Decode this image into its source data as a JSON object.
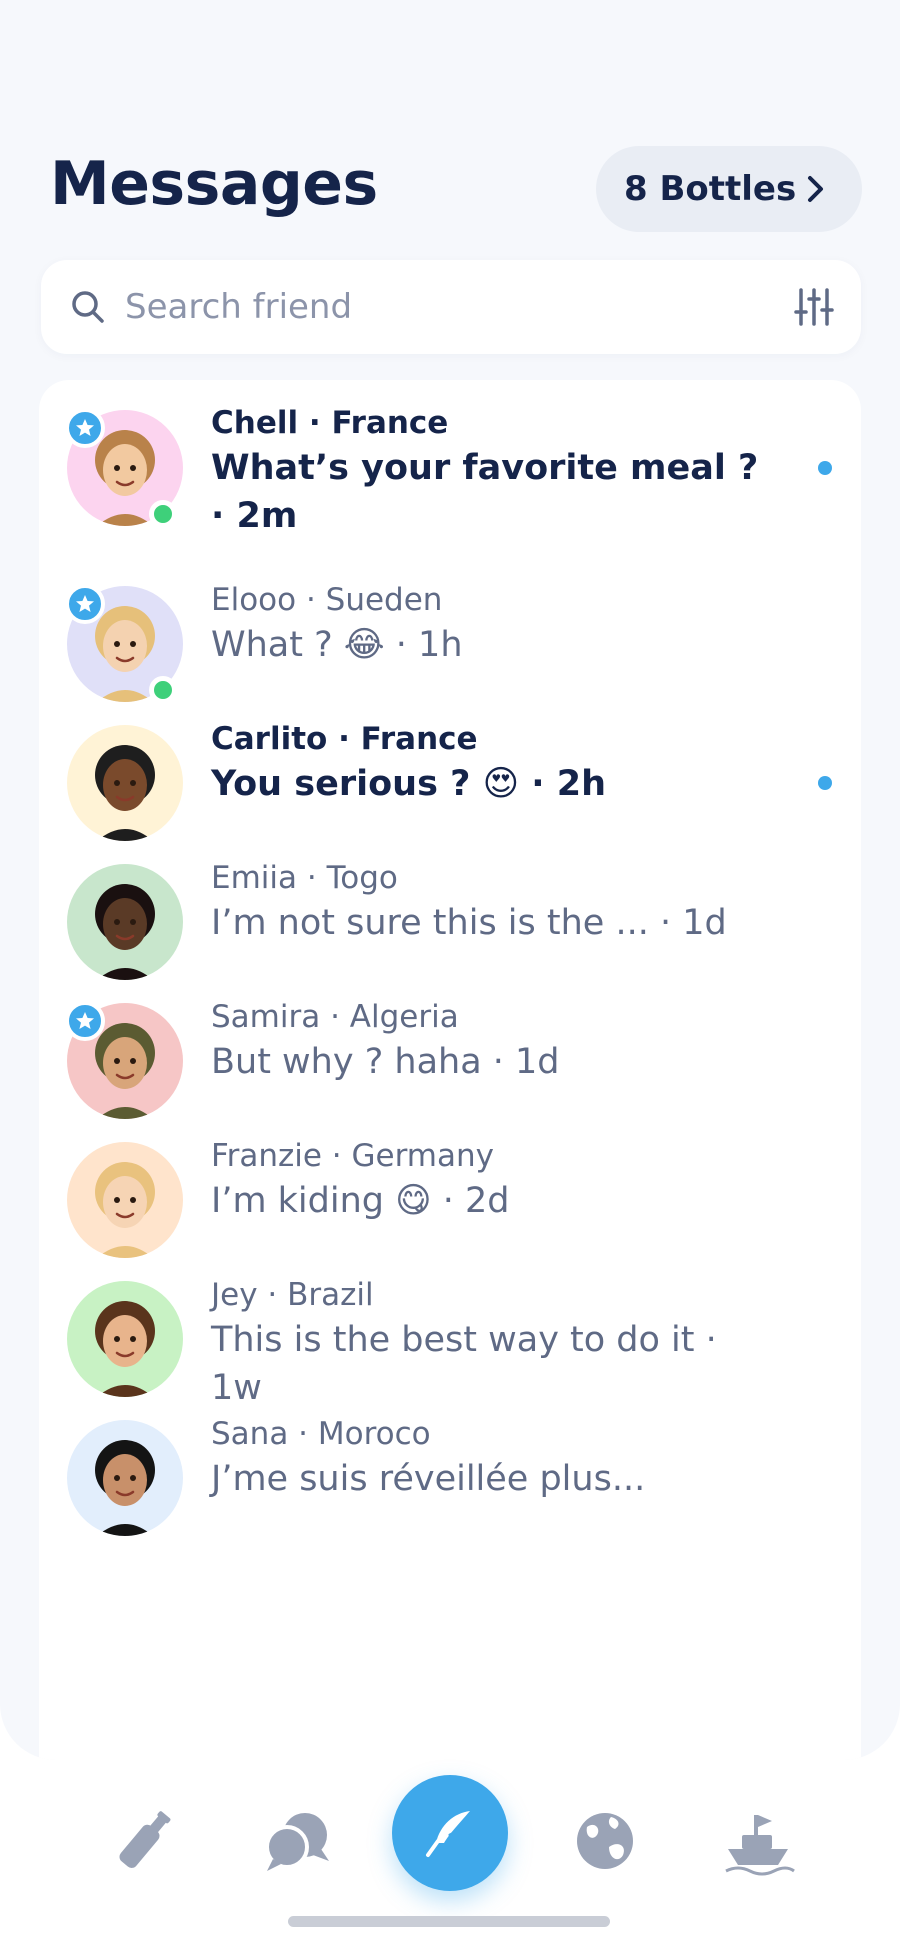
{
  "header": {
    "title": "Messages",
    "bottles_label": "8 Bottles"
  },
  "search": {
    "placeholder": "Search friend",
    "value": ""
  },
  "conversations": [
    {
      "name": "Chell · France",
      "message": "What’s your favorite meal ? · 2m",
      "unread": true,
      "premium": true,
      "online": true,
      "avatar_bg": "#fcd4ef"
    },
    {
      "name": "Elooo · Sueden",
      "message": "What ? 😂 · 1h",
      "unread": false,
      "premium": true,
      "online": true,
      "avatar_bg": "#e0e0f8"
    },
    {
      "name": "Carlito · France",
      "message": "You serious ? 😍 · 2h",
      "unread": true,
      "premium": false,
      "online": false,
      "avatar_bg": "#fff3d6"
    },
    {
      "name": "Emiia · Togo",
      "message": "I’m not sure this is the ... · 1d",
      "unread": false,
      "premium": false,
      "online": false,
      "avatar_bg": "#c8e6cc"
    },
    {
      "name": "Samira · Algeria",
      "message": "But why ? haha · 1d",
      "unread": false,
      "premium": true,
      "online": false,
      "avatar_bg": "#f6c6c6"
    },
    {
      "name": "Franzie · Germany",
      "message": "I’m kiding 😋 · 2d",
      "unread": false,
      "premium": false,
      "online": false,
      "avatar_bg": "#ffe4cc"
    },
    {
      "name": "Jey · Brazil",
      "message": "This is the best way to do it · 1w",
      "unread": false,
      "premium": false,
      "online": false,
      "avatar_bg": "#c8f2c4"
    },
    {
      "name": "Sana · Moroco",
      "message": "J’me suis réveillée plus...",
      "unread": false,
      "premium": false,
      "online": false,
      "avatar_bg": "#e2eefc"
    }
  ],
  "tabbar": {
    "items": [
      "bottle-icon",
      "chat-bubbles-icon",
      "quill-icon",
      "globe-icon",
      "ship-icon"
    ],
    "active": "quill-icon"
  },
  "colors": {
    "accent": "#3ea8ea",
    "online": "#3ed07a",
    "title": "#15244a",
    "muted": "#5f6a85",
    "icon_inactive": "#9aa3b6",
    "background": "#f6f8fc"
  }
}
